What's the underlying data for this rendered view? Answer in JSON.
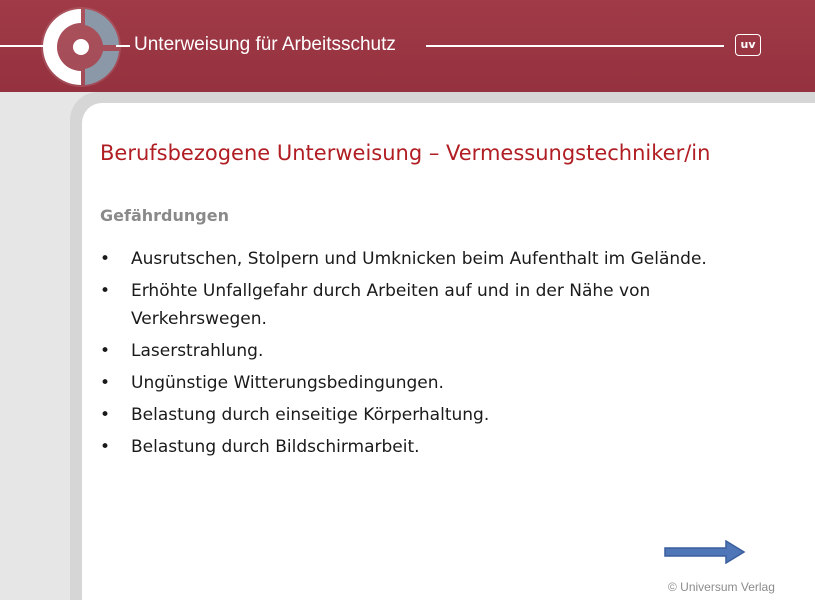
{
  "header": {
    "title": "Unterweisung für Arbeitsschutz",
    "badge": "uv",
    "brand_color": "#9c3844"
  },
  "slide": {
    "title": "Berufsbezogene Unterweisung – Vermessungstechniker/in",
    "subtitle": "Gefährdungen",
    "bullet_symbol": "•",
    "bullets": [
      "Ausrutschen, Stolpern und Umknicken beim Aufenthalt im Gelände.",
      "Erhöhte Unfallgefahr durch Arbeiten auf und in der Nähe von Verkehrswegen.",
      "Laserstrahlung.",
      "Ungünstige Witterungsbedingungen.",
      "Belastung durch einseitige Körperhaltung.",
      "Belastung durch Bildschirmarbeit."
    ],
    "title_color": "#b01d22"
  },
  "navigation": {
    "next_icon": "arrow-right-icon"
  },
  "footer": {
    "copyright": "© Universum Verlag"
  }
}
